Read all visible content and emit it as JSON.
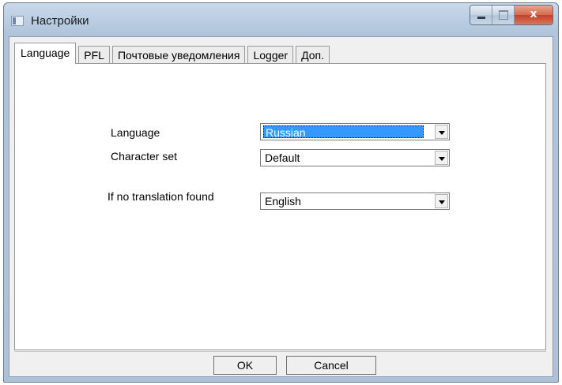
{
  "window": {
    "title": "Настройки",
    "icons": {
      "app": "app-window-icon",
      "minimize": "minimize-icon",
      "maximize": "maximize-icon",
      "close": "close-icon"
    },
    "close_glyph": "x"
  },
  "tabs": [
    {
      "label": "Language",
      "active": true
    },
    {
      "label": "PFL",
      "active": false
    },
    {
      "label": "Почтовые уведомления",
      "active": false
    },
    {
      "label": "Logger",
      "active": false
    },
    {
      "label": "Доп.",
      "active": false
    }
  ],
  "form": {
    "language": {
      "label": "Language",
      "value": "Russian"
    },
    "charset": {
      "label": "Character set",
      "value": "Default"
    },
    "fallback": {
      "label": "If no translation found",
      "value": "English"
    }
  },
  "buttons": {
    "ok": "OK",
    "cancel": "Cancel"
  },
  "colors": {
    "selection": "#3399ff",
    "close_button": "#c2412a"
  }
}
